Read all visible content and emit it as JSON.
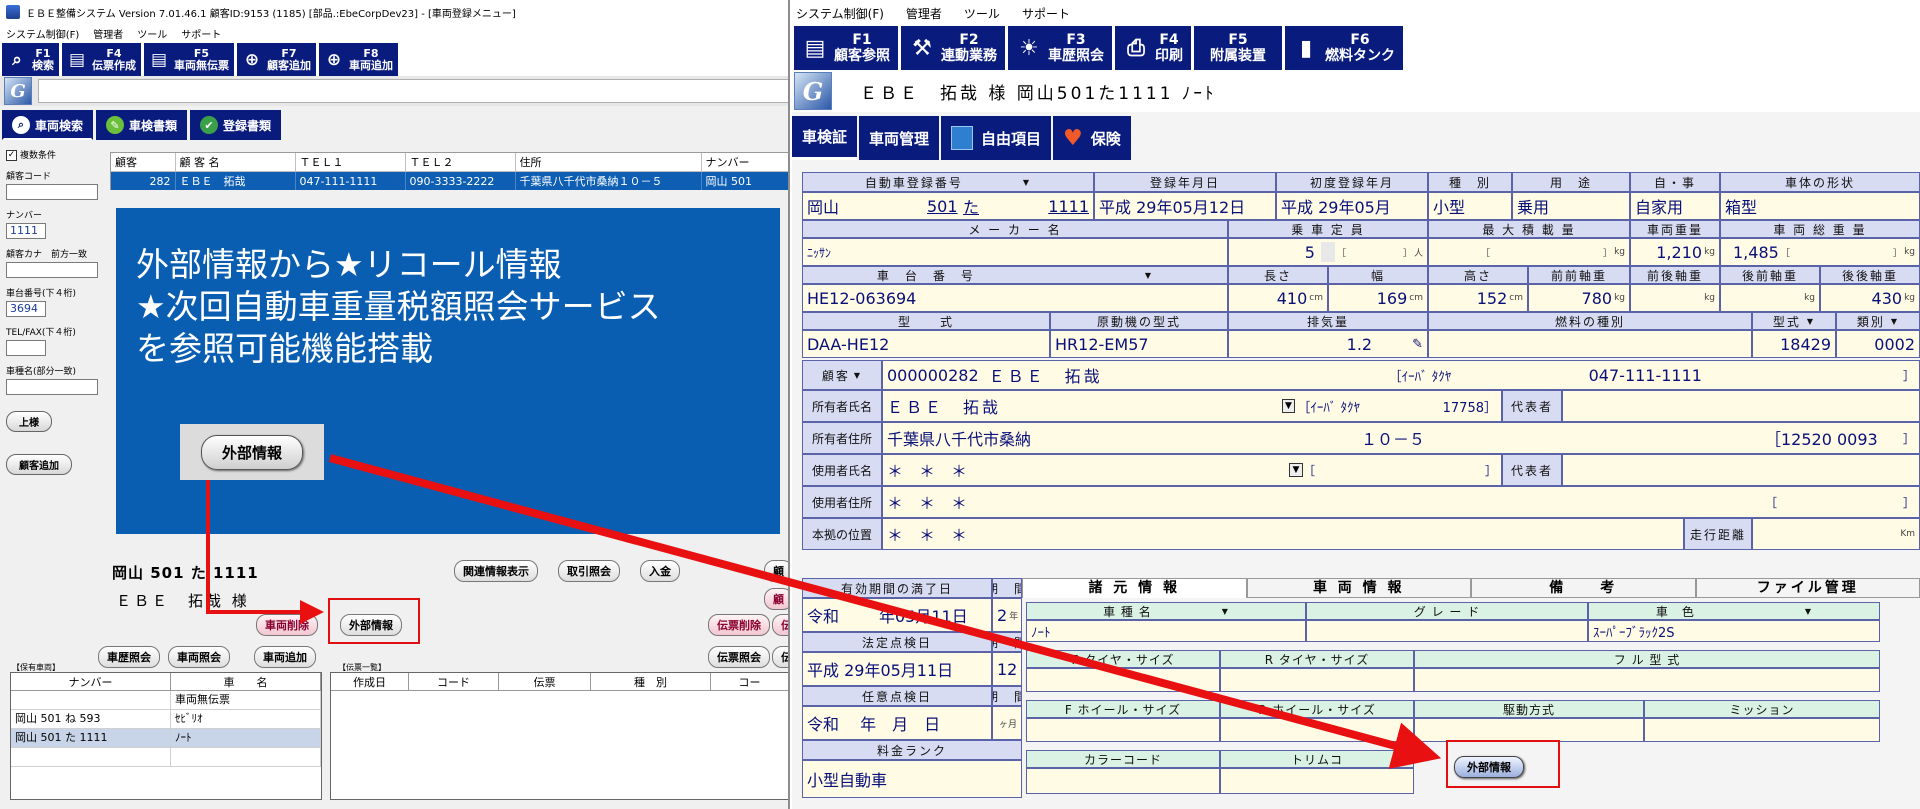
{
  "left_window": {
    "title": "ＥＢＥ整備システム Version 7.01.46.1 顧客ID:9153 (1185) [部品.:EbeCorpDev23] - [車両登録メニュー]",
    "menu": [
      "システム制御(F)",
      "管理者",
      "ツール",
      "サポート"
    ],
    "fkeys": [
      {
        "key": "F1",
        "label": "検索",
        "icon": "search-icon"
      },
      {
        "key": "F4",
        "label": "伝票作成",
        "icon": "document-icon"
      },
      {
        "key": "F5",
        "label": "車両無伝票",
        "icon": "document-icon"
      },
      {
        "key": "F7",
        "label": "顧客追加",
        "icon": "plus-icon"
      },
      {
        "key": "F8",
        "label": "車両追加",
        "icon": "plus-icon"
      }
    ],
    "tabs": [
      "車両検索",
      "車検書類",
      "登録書類"
    ],
    "search_panel": {
      "multi_condition": "複数条件",
      "customer_code_label": "顧客コード",
      "number_label": "ナンバー",
      "number_value": "1111",
      "kana_label": "顧客カナ　前方一致",
      "chassis_label": "車台番号(下４桁)",
      "chassis_value": "3694",
      "tel_label": "TEL/FAX(下４桁)",
      "car_name_label": "車種名(部分一致)",
      "btn_honorific": "上様",
      "btn_add_customer": "顧客追加"
    },
    "grid": {
      "headers": [
        "顧客",
        "顧 客 名",
        "ＴＥＬ１",
        "ＴＥＬ２",
        "住所",
        "ナンバー"
      ],
      "row": [
        "282",
        "ＥＢＥ　拓哉",
        "047-111-1111",
        "090-3333-2222",
        "千葉県八千代市桑納１０－５",
        "岡山 501"
      ]
    },
    "banner_lines": [
      "外部情報から★リコール情報",
      "★次回自動車重量税額照会サービス",
      "を参照可能機能搭載"
    ],
    "callout_button": "外部情報",
    "plate": "岡山 501 た 1111",
    "customer": "ＥＢＥ　拓哉 様",
    "buttons": {
      "related": "関連情報表示",
      "transactions": "取引照会",
      "payment": "入金",
      "vehicle_delete": "車両削除",
      "external_info": "外部情報",
      "history": "車歴照会",
      "vehicle_inquiry": "車両照会",
      "vehicle_add": "車両追加",
      "slip_delete": "伝票削除",
      "slip_inquiry": "伝票照会",
      "cust_cut": "顧",
      "cust_cut2": "顧",
      "den_cut": "伝",
      "den_cut2": "伝"
    },
    "owned_label": "【保有車両】",
    "owned_headers": [
      "ナンバー",
      "車　　名"
    ],
    "owned_rows": [
      {
        "number": "",
        "name": "車両無伝票"
      },
      {
        "number": "岡山 501 ね 593",
        "name": "ｾﾋﾞﾘｵ"
      },
      {
        "number": "岡山 501 た 1111",
        "name": "ﾉｰﾄ"
      }
    ],
    "slip_label": "【伝票一覧】",
    "slip_headers": [
      "作成日",
      "コード",
      "伝票",
      "種　別",
      "コー"
    ]
  },
  "right_window": {
    "menu": [
      "システム制御(F)",
      "管理者",
      "ツール",
      "サポート"
    ],
    "fkeys": [
      {
        "key": "F1",
        "label": "顧客参照",
        "icon": "book-icon"
      },
      {
        "key": "F2",
        "label": "連動業務",
        "icon": "wrench-icon"
      },
      {
        "key": "F3",
        "label": "車歴照会",
        "icon": "bulb-icon"
      },
      {
        "key": "F4",
        "label": "印刷",
        "icon": "printer-icon"
      },
      {
        "key": "F5",
        "label": "附属装置",
        "icon": "none"
      },
      {
        "key": "F6",
        "label": "燃料タンク",
        "icon": "tank-icon"
      }
    ],
    "title": "ＥＢＥ　拓哉 様 岡山501た1111 ﾉｰﾄ",
    "tabs": [
      "車検証",
      "車両管理",
      "自由項目",
      "保険"
    ],
    "form": {
      "reg_no_h": "自動車登録番号",
      "reg_date_h": "登録年月日",
      "first_reg_h": "初度登録年月",
      "kind_h": "種　別",
      "use_h": "用　途",
      "own_h": "自・事",
      "shape_h": "車体の形状",
      "plate_area": "岡山",
      "plate_class": "501",
      "plate_kana": "た",
      "plate_num": "1111",
      "reg_date": "平成 29年05月12日",
      "first_reg": "平成 29年05月",
      "kind": "小型",
      "use": "乗用",
      "own": "自家用",
      "shape": "箱型",
      "maker_h": "メ ー カ ー 名",
      "capacity_h": "乗 車 定 員",
      "max_load_h": "最 大 積 載 量",
      "weight_h": "車両重量",
      "gross_h": "車 両 総 重 量",
      "maker": "ﾆｯｻﾝ",
      "capacity": "5",
      "capacity_unit": "人",
      "kg": "kg",
      "weight": "1,210",
      "gross": "1,485",
      "bracket_open": "［",
      "bracket_close": "］",
      "chassis_h": "車　台　番　号",
      "length_h": "長さ",
      "width_h": "幅",
      "height_h": "高さ",
      "ff_h": "前前軸重",
      "fr_h": "前後軸重",
      "rf_h": "後前軸重",
      "rr_h": "後後軸重",
      "chassis": "HE12-063694",
      "cm": "cm",
      "length": "410",
      "width": "169",
      "height": "152",
      "ff": "780",
      "rr": "430",
      "model_h": "型　　式",
      "engine_h": "原動機の型式",
      "displacement_h": "排気量",
      "fuel_h": "燃料の種別",
      "type_h": "型式",
      "cat_h": "類別",
      "model": "DAA-HE12",
      "engine": "HR12-EM57",
      "displacement": "1.2",
      "type_no": "18429",
      "cat_no": "0002",
      "customer_h": "顧客",
      "customer_code": "000000282",
      "customer_name": "ＥＢＥ　拓哉",
      "customer_kana": "［ｲｰﾊﾞ ﾀｸﾔ",
      "customer_tel": "047-111-1111",
      "owner_name_h": "所有者氏名",
      "owner_name": "ＥＢＥ　拓哉",
      "owner_kana": "［ｲｰﾊﾞ ﾀｸﾔ",
      "owner_code": "17758］",
      "rep_h": "代表者",
      "owner_addr_h": "所有者住所",
      "owner_addr": "千葉県八千代市桑納",
      "owner_addr2": "１０－５",
      "owner_zip": "［12520 0093",
      "user_name_h": "使用者氏名",
      "user_name": "＊　＊　＊",
      "user_addr_h": "使用者住所",
      "user_addr": "＊　＊　＊",
      "base_h": "本拠の位置",
      "base": "＊　＊　＊",
      "mileage_h": "走行距離",
      "km": "Km",
      "expiry_h": "有効期間の満了日",
      "period_h": "期　間",
      "expiry": "令和",
      "expiry_tail": "年05月11日",
      "period": "2",
      "period_unit": "年",
      "legal_h": "法定点検日",
      "legal": "平成 29年05月11日",
      "legal_period": "12",
      "month_unit": "ヶ月",
      "optional_h": "任意点検日",
      "optional": "令和　 年　月　日",
      "fee_h": "料金ランク",
      "fee": "小型自動車"
    },
    "subtabs": [
      "諸 元 情 報",
      "車 両 情 報",
      "備　　考",
      "ファイル管理"
    ],
    "spec": {
      "car_name_h": "車 種 名",
      "grade_h": "グ レ ー ド",
      "color_h": "車　色",
      "car_name": "ﾉｰﾄ",
      "color": "ｽｰﾊﾟｰﾌﾞﾗｯｸ2S",
      "ftire_h": "F タイヤ・サイズ",
      "rtire_h": "R タイヤ・サイズ",
      "full_model_h": "フ ル 型 式",
      "fwheel_h": "F ホイール・サイズ",
      "rwheel_h": "R ホイール・サイズ",
      "drive_h": "駆動方式",
      "mission_h": "ミッション",
      "colorcode_h": "カラーコード",
      "trim_h": "トリムコ",
      "external_btn": "外部情報"
    }
  }
}
